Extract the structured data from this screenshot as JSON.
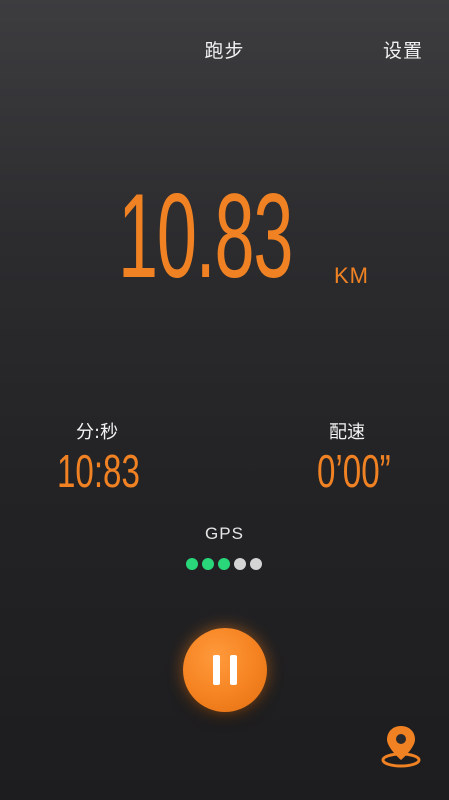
{
  "header": {
    "title": "跑步",
    "settings_label": "设置"
  },
  "distance": {
    "value": "10.83",
    "unit": "KM"
  },
  "stats": {
    "time": {
      "label": "分:秒",
      "value": "10:83"
    },
    "pace": {
      "label": "配速",
      "value": "0’00”"
    }
  },
  "gps": {
    "label": "GPS",
    "signal_total": 5,
    "signal_active": 3
  },
  "icons": {
    "pause": "pause-icon",
    "location": "location-pin-icon"
  },
  "colors": {
    "accent": "#f08223",
    "gps_active": "#2ad67a",
    "gps_inactive": "#d4d4d4",
    "text": "#f2f2f2"
  }
}
